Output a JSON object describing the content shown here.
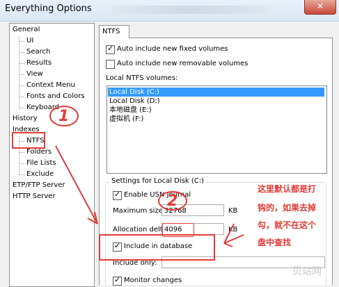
{
  "window": {
    "title": "Everything Options",
    "close_label": "✕"
  },
  "tree": {
    "general": "General",
    "ui": "UI",
    "search": "Search",
    "results": "Results",
    "view": "View",
    "context_menu": "Context Menu",
    "fonts_colors": "Fonts and Colors",
    "keyboard": "Keyboard",
    "history": "History",
    "indexes": "Indexes",
    "ntfs": "NTFS",
    "folders": "Folders",
    "file_lists": "File Lists",
    "exclude": "Exclude",
    "etp_ftp": "ETP/FTP Server",
    "http": "HTTP Server"
  },
  "tab": {
    "label": "NTFS"
  },
  "options": {
    "auto_fixed": "Auto include new fixed volumes",
    "auto_fixed_checked": true,
    "auto_removable": "Auto include new removable volumes",
    "auto_removable_checked": false,
    "local_volumes_label": "Local NTFS volumes:"
  },
  "volumes": [
    {
      "label": "Local Disk (C:)",
      "selected": true
    },
    {
      "label": "Local Disk (D:)",
      "selected": false
    },
    {
      "label": "本地磁盘 (E:)",
      "selected": false
    },
    {
      "label": "虚拟机 (F:)",
      "selected": false
    }
  ],
  "settings": {
    "group_title": "Settings for Local Disk (C:)",
    "enable_usn": "Enable USN Journal",
    "enable_usn_checked": true,
    "max_size_label": "Maximum size:",
    "max_size_value": "32768",
    "max_size_unit": "KB",
    "alloc_label": "Allocation delta:",
    "alloc_value": "4096",
    "alloc_unit": "KB",
    "include_db": "Include in database",
    "include_db_checked": true,
    "include_only_label": "Include only:",
    "include_only_value": "",
    "monitor_changes": "Monitor changes",
    "monitor_changes_checked": true
  },
  "annotations": {
    "num1": "1",
    "num2": "2",
    "note_line1": "这里默认都是打",
    "note_line2": "钩的，如果去掉",
    "note_line3": "勾，就不在这个",
    "note_line4": "盘中查找",
    "watermark": "贝站网",
    "color": "#e23b36"
  }
}
